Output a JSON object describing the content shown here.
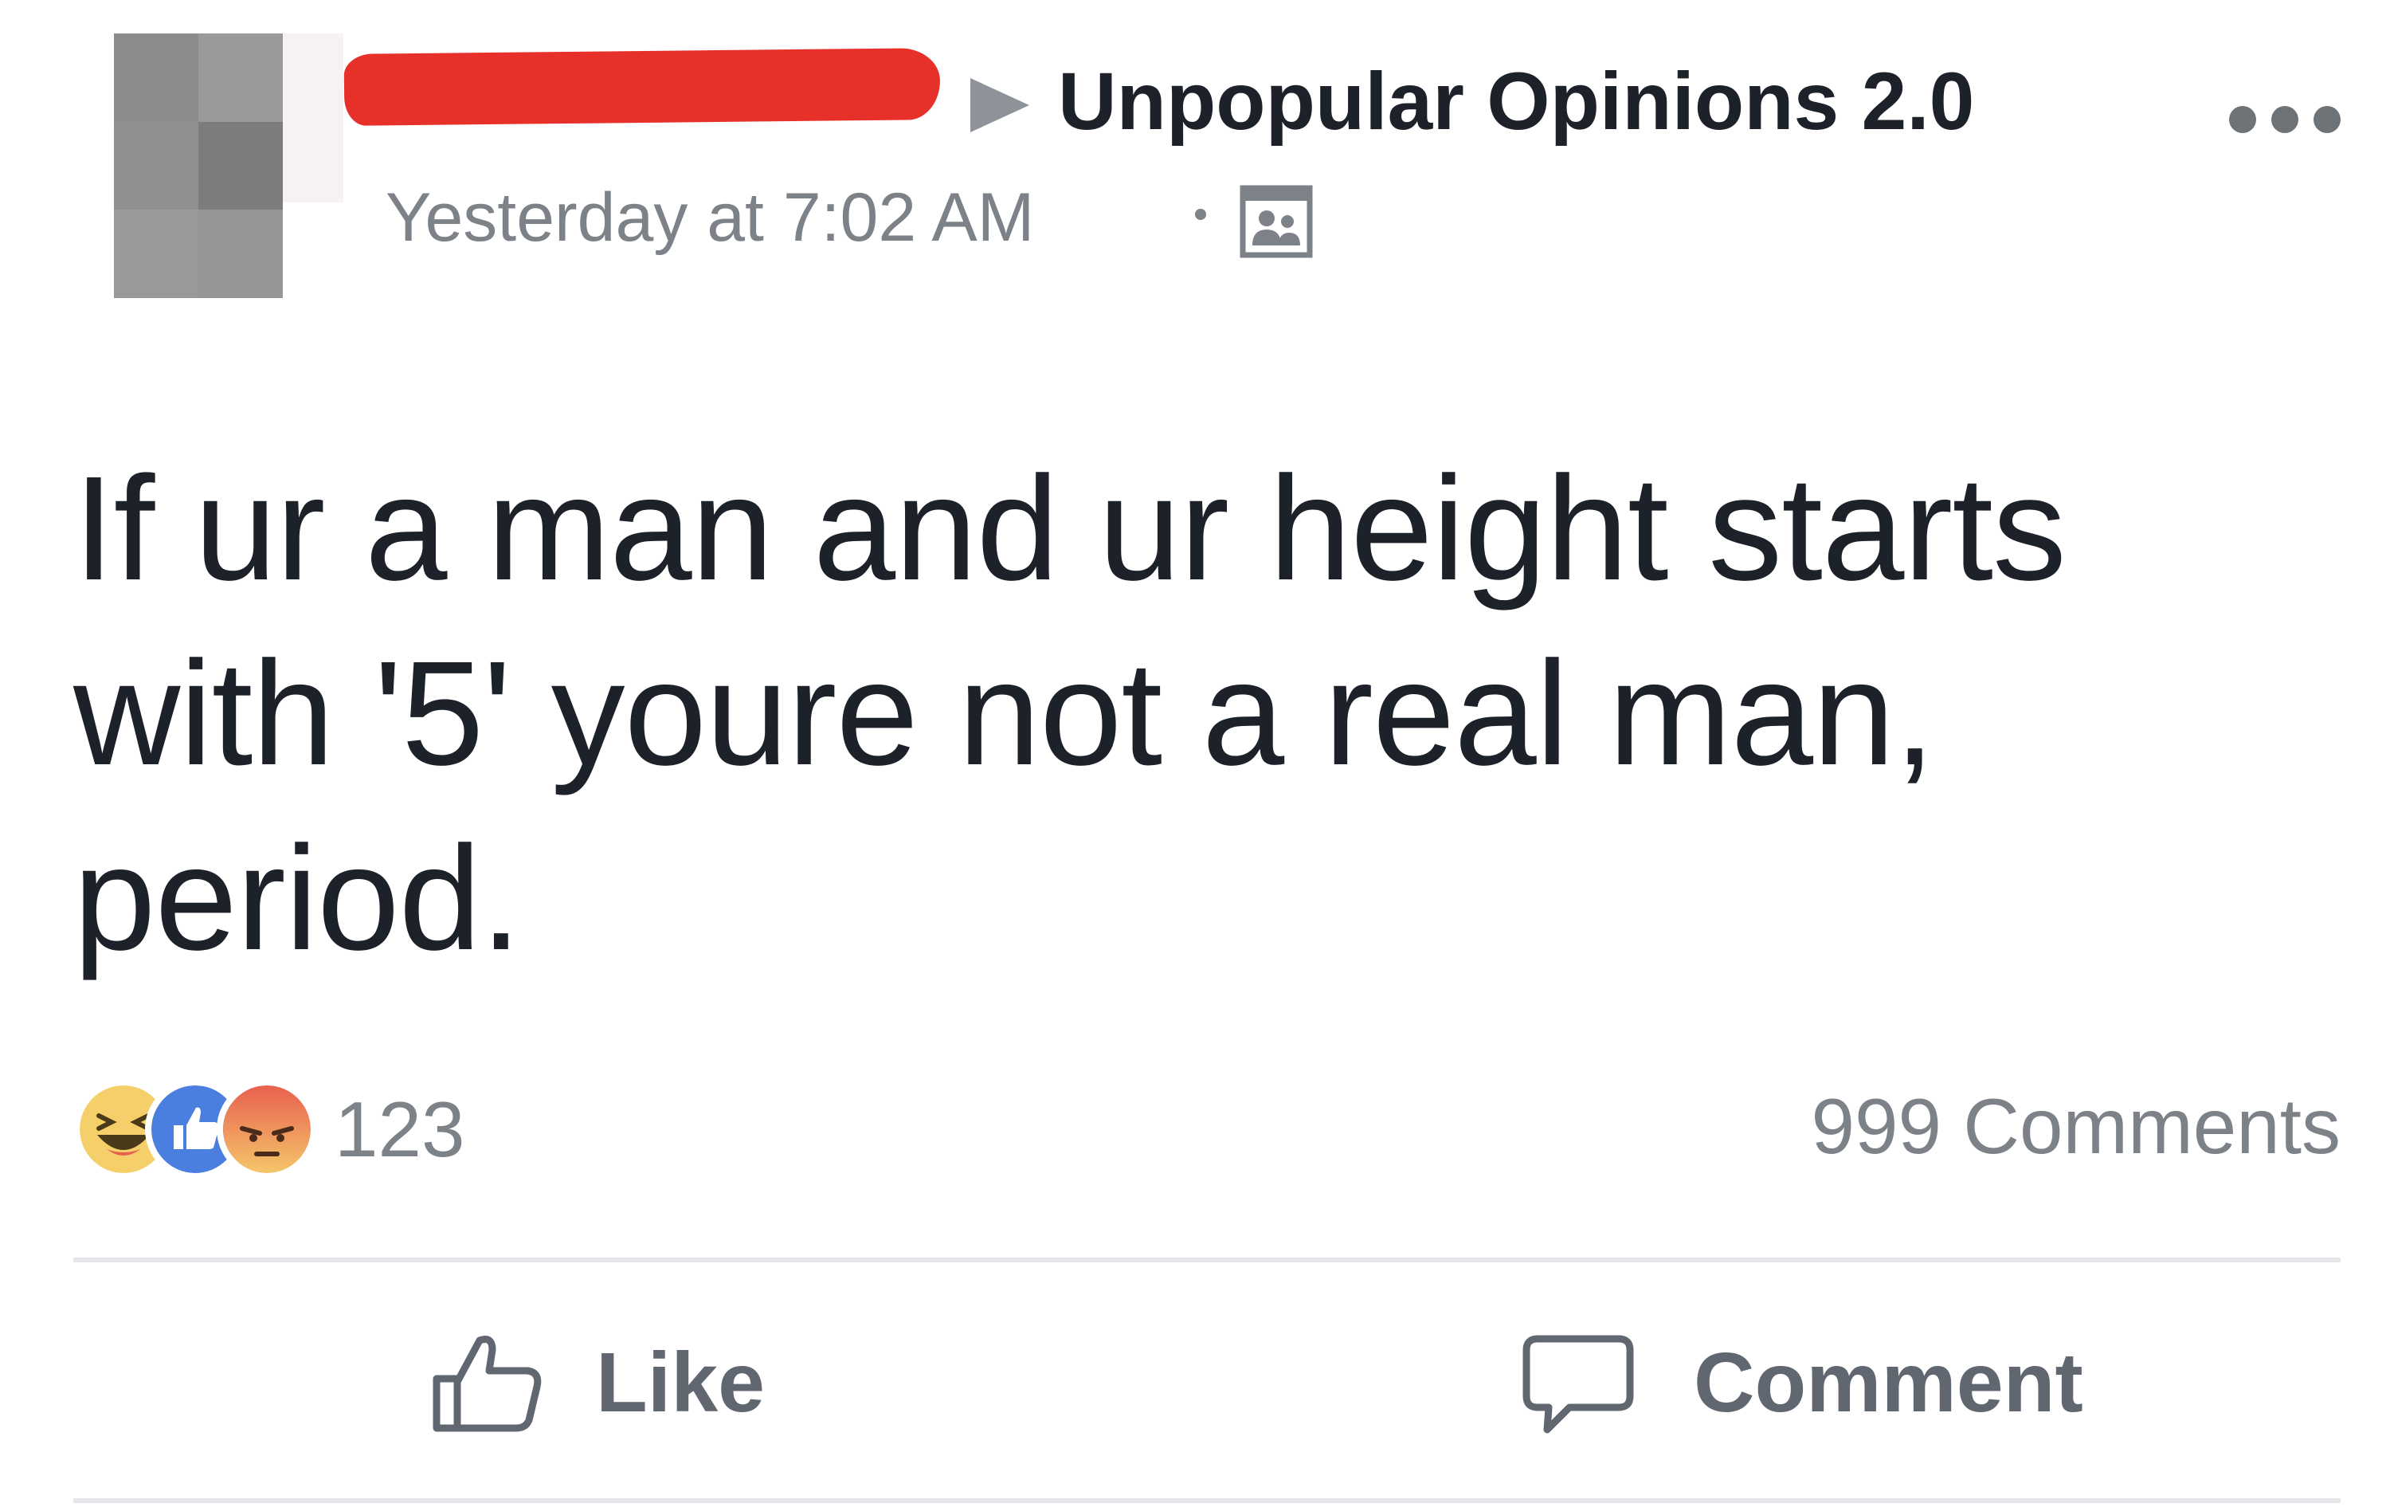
{
  "header": {
    "group_name": "Unpopular Opinions 2.0",
    "timestamp": "Yesterday at 7:02 AM",
    "audience_icon": "group-icon",
    "more_icon": "more-options-icon"
  },
  "post": {
    "text": "If ur a man and ur height starts with '5' youre not a real man, period."
  },
  "reactions": {
    "icons": [
      "haha",
      "like",
      "angry"
    ],
    "count": "123"
  },
  "comments": {
    "count_label": "999 Comments"
  },
  "actions": {
    "like_label": "Like",
    "comment_label": "Comment"
  },
  "colors": {
    "redaction": "#e8302a",
    "like_blue": "#4a7fe0",
    "haha_yellow": "#f5d06a",
    "angry_red": "#e8604f",
    "secondary_text": "#7d8288"
  }
}
